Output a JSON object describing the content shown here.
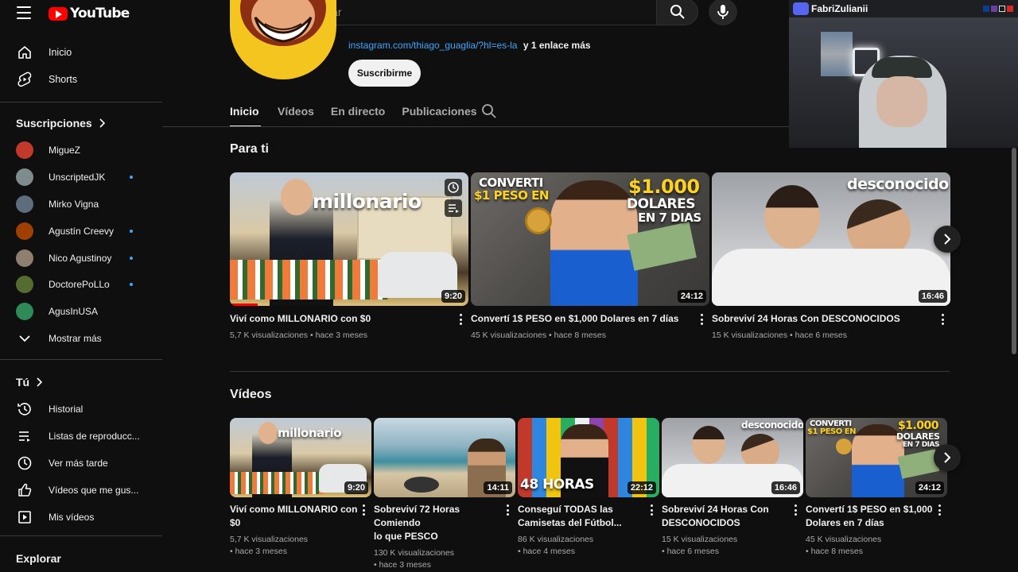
{
  "topbar": {
    "logo_text": "YouTube",
    "search_placeholder": "Buscar"
  },
  "sidebar": {
    "main": [
      {
        "label": "Inicio",
        "icon": "home-icon"
      },
      {
        "label": "Shorts",
        "icon": "shorts-icon"
      }
    ],
    "subscriptions_title": "Suscripciones",
    "subscriptions": [
      {
        "label": "MigueZ",
        "color": "#c0392b",
        "dot": false
      },
      {
        "label": "UnscriptedJK",
        "color": "#7f8c8d",
        "dot": true
      },
      {
        "label": "Mirko Vigna",
        "color": "#5d6d7e",
        "dot": false
      },
      {
        "label": "Agustín Creevy",
        "color": "#a04000",
        "dot": true
      },
      {
        "label": "Nico Agustinoy",
        "color": "#8e7f6f",
        "dot": true
      },
      {
        "label": "DoctorePoLLo",
        "color": "#556b2f",
        "dot": true
      },
      {
        "label": "AgusInUSA",
        "color": "#2e8b57",
        "dot": false
      }
    ],
    "show_more": "Mostrar más",
    "you_title": "Tú",
    "you_items": [
      {
        "label": "Historial",
        "icon": "history-icon"
      },
      {
        "label": "Listas de reproducc...",
        "icon": "playlists-icon"
      },
      {
        "label": "Ver más tarde",
        "icon": "watch-later-icon"
      },
      {
        "label": "Vídeos que me gus...",
        "icon": "like-icon"
      },
      {
        "label": "Mis vídeos",
        "icon": "my-videos-icon"
      }
    ],
    "explore_title": "Explorar"
  },
  "channel": {
    "link": "instagram.com/thiago_guaglia/?hl=es-la",
    "more_links": "y 1 enlace más",
    "subscribe_label": "Suscribirme",
    "tabs": [
      "Inicio",
      "Vídeos",
      "En directo",
      "Publicaciones"
    ]
  },
  "for_you": {
    "title": "Para ti",
    "videos": [
      {
        "title": "Viví como MILLONARIO con $0",
        "views": "5,7 K visualizaciones",
        "age": "hace 3 meses",
        "duration": "9:20",
        "caption": "millonario"
      },
      {
        "title": "Convertí 1$ PESO en $1,000 Dolares en 7 días",
        "views": "45 K visualizaciones",
        "age": "hace 8 meses",
        "duration": "24:12",
        "caption_a": "CONVERTI",
        "caption_b": "$1 PESO EN",
        "caption_c": "$1.000",
        "caption_d": "DOLARES",
        "caption_e": "EN 7 DIAS"
      },
      {
        "title": "Sobreviví 24 Horas Con DESCONOCIDOS",
        "views": "15 K visualizaciones",
        "age": "hace 6 meses",
        "duration": "16:46",
        "caption": "desconocido"
      }
    ]
  },
  "videos_section": {
    "title": "Vídeos",
    "videos": [
      {
        "title_1": "Viví como MILLONARIO con",
        "title_2": "$0",
        "views": "5,7 K visualizaciones",
        "age": "hace 3 meses",
        "duration": "9:20",
        "caption": "millonario"
      },
      {
        "title_1": "Sobreviví 72 Horas Comiendo",
        "title_2": "lo que PESCO",
        "views": "130 K visualizaciones",
        "age": "hace 3 meses",
        "duration": "14:11"
      },
      {
        "title_1": "Conseguí TODAS las",
        "title_2": "Camisetas del Fútbol...",
        "views": "86 K visualizaciones",
        "age": "hace 4 meses",
        "duration": "22:12",
        "caption": "48 HORAS"
      },
      {
        "title_1": "Sobreviví 24 Horas Con",
        "title_2": "DESCONOCIDOS",
        "views": "15 K visualizaciones",
        "age": "hace 6 meses",
        "duration": "16:46",
        "caption": "desconocido"
      },
      {
        "title_1": "Convertí 1$ PESO en $1,000",
        "title_2": "Dolares en 7 días",
        "views": "45 K visualizaciones",
        "age": "hace 8 meses",
        "duration": "24:12",
        "caption_a": "CONVERTI",
        "caption_b": "$1 PESO EN",
        "caption_c": "$1.000",
        "caption_d": "DOLARES",
        "caption_e": "EN 7 DIAS"
      }
    ]
  },
  "webcam": {
    "username": "FabriZulianii"
  }
}
